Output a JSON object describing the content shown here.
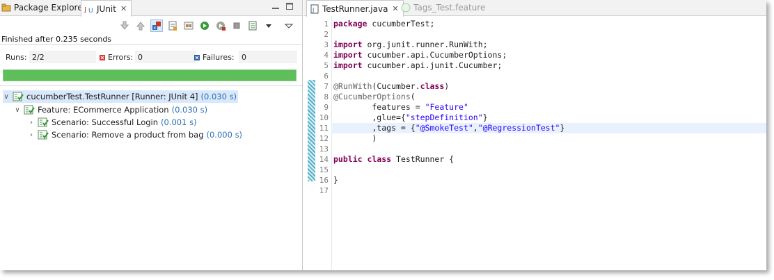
{
  "left_tabs": {
    "package_explorer": "Package Explorer",
    "junit": "JUnit"
  },
  "junit": {
    "finished": "Finished after 0.235 seconds",
    "runs_label": "Runs:",
    "runs_value": "2/2",
    "errors_label": "Errors:",
    "errors_value": "0",
    "failures_label": "Failures:",
    "failures_value": "0",
    "progress_fraction": 1.0,
    "status_color": "#5ebe5a",
    "tree": {
      "root_label": "cucumberTest.TestRunner [Runner: JUnit 4]",
      "root_time": "(0.030 s)",
      "feature_label": "Feature: ECommerce Application",
      "feature_time": "(0.030 s)",
      "scenario1_label": "Scenario: Successful Login",
      "scenario1_time": "(0.001 s)",
      "scenario2_label": "Scenario: Remove a product from bag",
      "scenario2_time": "(0.000 s)"
    }
  },
  "editor_tabs": {
    "active": "TestRunner.java",
    "inactive": "Tags_Test.feature"
  },
  "editor": {
    "line_numbers": [
      "1",
      "2",
      "3",
      "4",
      "5",
      "6",
      "7",
      "8",
      "9",
      "10",
      "11",
      "12",
      "13",
      "14",
      "15",
      "16",
      "17"
    ],
    "highlighted_line": 11,
    "lines": [
      {
        "segments": [
          {
            "cls": "kw",
            "t": "package"
          },
          {
            "cls": "",
            "t": " cucumberTest;"
          }
        ]
      },
      {
        "segments": []
      },
      {
        "segments": [
          {
            "cls": "kw",
            "t": "import"
          },
          {
            "cls": "",
            "t": " org.junit.runner.RunWith;"
          }
        ]
      },
      {
        "segments": [
          {
            "cls": "kw",
            "t": "import"
          },
          {
            "cls": "",
            "t": " cucumber.api.CucumberOptions;"
          }
        ]
      },
      {
        "segments": [
          {
            "cls": "kw",
            "t": "import"
          },
          {
            "cls": "",
            "t": " cucumber.api.junit.Cucumber;"
          }
        ]
      },
      {
        "segments": []
      },
      {
        "segments": [
          {
            "cls": "ann",
            "t": "@RunWith"
          },
          {
            "cls": "",
            "t": "(Cucumber."
          },
          {
            "cls": "kw",
            "t": "class"
          },
          {
            "cls": "",
            "t": ")"
          }
        ]
      },
      {
        "segments": [
          {
            "cls": "ann",
            "t": "@CucumberOptions"
          },
          {
            "cls": "",
            "t": "("
          }
        ]
      },
      {
        "segments": [
          {
            "cls": "",
            "t": "        features = "
          },
          {
            "cls": "str",
            "t": "\"Feature\""
          }
        ]
      },
      {
        "segments": [
          {
            "cls": "",
            "t": "        ,glue={"
          },
          {
            "cls": "str",
            "t": "\"stepDefinition\""
          },
          {
            "cls": "",
            "t": "}"
          }
        ]
      },
      {
        "segments": [
          {
            "cls": "",
            "t": "        ,tags = {"
          },
          {
            "cls": "str",
            "t": "\"@SmokeTest\""
          },
          {
            "cls": "",
            "t": ","
          },
          {
            "cls": "str",
            "t": "\"@RegressionTest\""
          },
          {
            "cls": "",
            "t": "}"
          }
        ]
      },
      {
        "segments": [
          {
            "cls": "",
            "t": "        )"
          }
        ]
      },
      {
        "segments": []
      },
      {
        "segments": [
          {
            "cls": "kw",
            "t": "public"
          },
          {
            "cls": "",
            "t": " "
          },
          {
            "cls": "kw",
            "t": "class"
          },
          {
            "cls": "",
            "t": " TestRunner {"
          }
        ]
      },
      {
        "segments": []
      },
      {
        "segments": [
          {
            "cls": "",
            "t": "}"
          }
        ]
      },
      {
        "segments": []
      }
    ]
  }
}
